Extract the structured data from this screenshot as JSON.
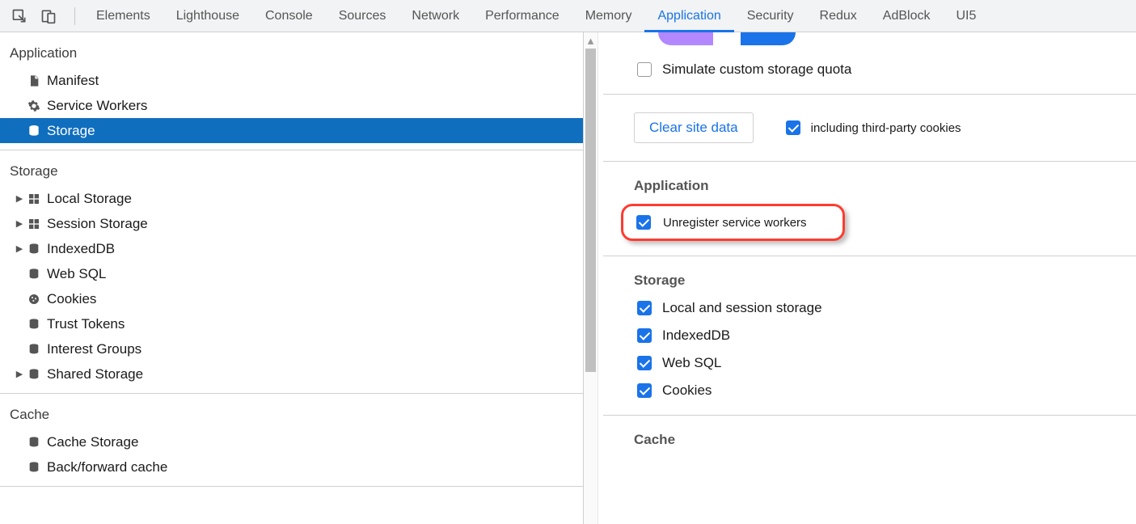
{
  "tabs": {
    "elements": "Elements",
    "lighthouse": "Lighthouse",
    "console": "Console",
    "sources": "Sources",
    "network": "Network",
    "performance": "Performance",
    "memory": "Memory",
    "application": "Application",
    "security": "Security",
    "redux": "Redux",
    "adblock": "AdBlock",
    "ui5": "UI5"
  },
  "sidebar": {
    "application": {
      "header": "Application",
      "manifest": "Manifest",
      "service_workers": "Service Workers",
      "storage": "Storage"
    },
    "storage": {
      "header": "Storage",
      "local_storage": "Local Storage",
      "session_storage": "Session Storage",
      "indexeddb": "IndexedDB",
      "web_sql": "Web SQL",
      "cookies": "Cookies",
      "trust_tokens": "Trust Tokens",
      "interest_groups": "Interest Groups",
      "shared_storage": "Shared Storage"
    },
    "cache": {
      "header": "Cache",
      "cache_storage": "Cache Storage",
      "back_forward": "Back/forward cache"
    }
  },
  "right": {
    "simulate_quota": "Simulate custom storage quota",
    "clear_site_data": "Clear site data",
    "including_tp": "including third-party cookies",
    "app_header": "Application",
    "unregister_sw": "Unregister service workers",
    "storage_header": "Storage",
    "local_session": "Local and session storage",
    "indexeddb": "IndexedDB",
    "web_sql": "Web SQL",
    "cookies": "Cookies",
    "cache_header": "Cache"
  }
}
